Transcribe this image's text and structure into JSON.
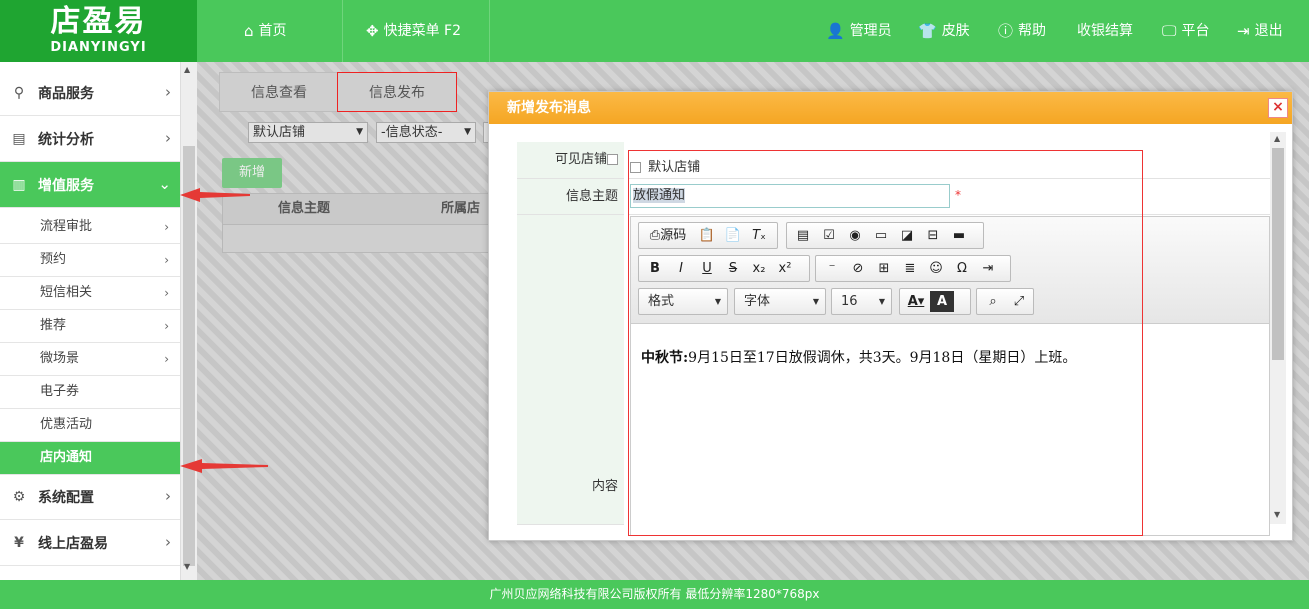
{
  "logo": {
    "name": "店盈易",
    "sub": "DIANYINGYI"
  },
  "topnav": {
    "home": "首页",
    "quick_menu": "快捷菜单 F2",
    "admin": "管理员",
    "skin": "皮肤",
    "help": "帮助",
    "checkout": "收银结算",
    "platform": "平台",
    "logout": "退出"
  },
  "sidebar": {
    "goods": "商品服务",
    "stats": "统计分析",
    "value_added": "增值服务",
    "sub_items": [
      "流程审批",
      "预约",
      "短信相关",
      "推荐",
      "微场景",
      "电子券",
      "优惠活动",
      "店内通知"
    ],
    "system": "系统配置",
    "online": "线上店盈易"
  },
  "tabs": {
    "view": "信息查看",
    "publish": "信息发布"
  },
  "filters": {
    "store": "默认店铺",
    "status": "-信息状态-"
  },
  "add_button": "新增",
  "table": {
    "col_subject": "信息主题",
    "col_store": "所属店铺"
  },
  "dialog": {
    "title": "新增发布消息",
    "close": "×",
    "label_visible_store": "可见店铺",
    "store_option": "默认店铺",
    "label_subject": "信息主题",
    "subject_value": "放假通知",
    "required_mark": "*",
    "label_content": "内容",
    "toolbar": {
      "source": "源码",
      "format": "格式",
      "font": "字体",
      "size": "16"
    },
    "content": {
      "bold": "中秋节:",
      "text": "9月15日至17日放假调休，共3天。9月18日（星期日）上班。"
    }
  },
  "footer": "广州贝应网络科技有限公司版权所有 最低分辨率1280*768px",
  "colors": {
    "brand_green": "#4ac85b",
    "logo_green": "#1fa531",
    "dialog_orange": "#f5a623",
    "highlight_red": "#e33"
  }
}
